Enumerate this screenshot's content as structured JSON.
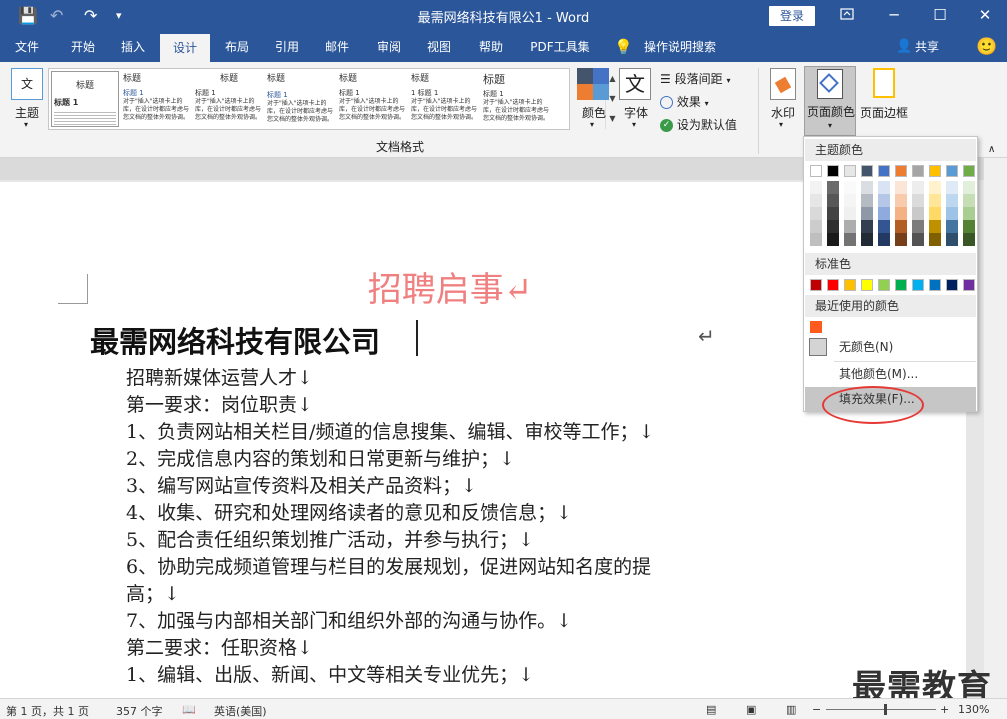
{
  "window": {
    "title": "最需网络科技有限公1 - Word",
    "login_label": "登录",
    "restore_icon": "ribbon-display-icon",
    "minimize": "─",
    "maximize": "☐",
    "close": "✕"
  },
  "quick_access": {
    "save": "💾",
    "undo": "↶",
    "redo": "↷",
    "more": "▾"
  },
  "tabs": [
    "文件",
    "开始",
    "插入",
    "设计",
    "布局",
    "引用",
    "邮件",
    "审阅",
    "视图",
    "帮助",
    "PDF工具集",
    "操作说明搜索"
  ],
  "share_label": "共享",
  "ribbon": {
    "theme_label": "主题",
    "gallery_items": [
      {
        "title": "标题",
        "heading": "标题 1",
        "text": ""
      },
      {
        "title": "标题",
        "heading": "标题 1",
        "text": "对于\"插入\"选项卡上的库，在设计时都应考虑与您文档的整体外观协调。"
      },
      {
        "title": "标题",
        "heading": "标题 1",
        "text": "对于\"插入\"选项卡上的库，在设计时都应考虑与您文档的整体外观协调。"
      },
      {
        "title": "标题",
        "heading": "标题 1",
        "text": "对于\"插入\"选项卡上的库，在设计时都应考虑与您文档的整体外观协调。"
      },
      {
        "title": "标题",
        "heading": "标题 1",
        "text": "对于\"插入\"选项卡上的库，在设计时都应考虑与您文档的整体外观协调。"
      },
      {
        "title": "标题",
        "heading": "1  标题 1",
        "text": "对于\"插入\"选项卡上的库，在设计时都应考虑与您文档的整体外观协调。"
      },
      {
        "title": "标题",
        "heading": "标题 1",
        "text": "对于\"插入\"选项卡上的库，在设计时都应考虑与您文档的整体外观协调。"
      }
    ],
    "colors_label": "颜色",
    "fonts_label": "字体",
    "fonts_glyph": "文",
    "paragraph_spacing": "段落间距",
    "effects": "效果",
    "set_default": "设为默认值",
    "group_label": "文档格式",
    "watermark_label": "水印",
    "page_color_label": "页面颜色",
    "page_border_label": "页面边框"
  },
  "document": {
    "heading": "招聘启事↵",
    "company": "最需网络科技有限公司",
    "enter_mark": "↵",
    "lines": [
      "招聘新媒体运营人才↓",
      "第一要求：岗位职责↓",
      "1、负责网站相关栏目/频道的信息搜集、编辑、审校等工作；↓",
      "2、完成信息内容的策划和日常更新与维护；↓",
      "3、编写网站宣传资料及相关产品资料；↓",
      "4、收集、研究和处理网络读者的意见和反馈信息；↓",
      "5、配合责任组织策划推广活动，并参与执行；↓",
      "6、协助完成频道管理与栏目的发展规划，促进网站知名度的提",
      "高；↓",
      "7、加强与内部相关部门和组织外部的沟通与协作。↓",
      "第二要求：任职资格↓",
      "1、编辑、出版、新闻、中文等相关专业优先；↓"
    ]
  },
  "dropdown": {
    "theme_colors_label": "主题颜色",
    "standard_colors_label": "标准色",
    "recent_colors_label": "最近使用的颜色",
    "no_color": "无颜色(N)",
    "more_colors": "其他颜色(M)...",
    "fill_effects": "填充效果(F)...",
    "theme_top_row": [
      "#ffffff",
      "#000000",
      "#e7e6e6",
      "#44546a",
      "#4472c4",
      "#ed7d31",
      "#a5a5a5",
      "#ffc000",
      "#5b9bd5",
      "#70ad47"
    ],
    "standard_colors": [
      "#c00000",
      "#ff0000",
      "#ffc000",
      "#ffff00",
      "#92d050",
      "#00b050",
      "#00b0f0",
      "#0070c0",
      "#002060",
      "#7030a0"
    ],
    "recent_color": "#ff5a1e"
  },
  "status": {
    "page": "第 1 页，共 1 页",
    "words": "357 个字",
    "language": "英语(美国)",
    "zoom": "130%"
  },
  "watermark_text": "最需教育"
}
